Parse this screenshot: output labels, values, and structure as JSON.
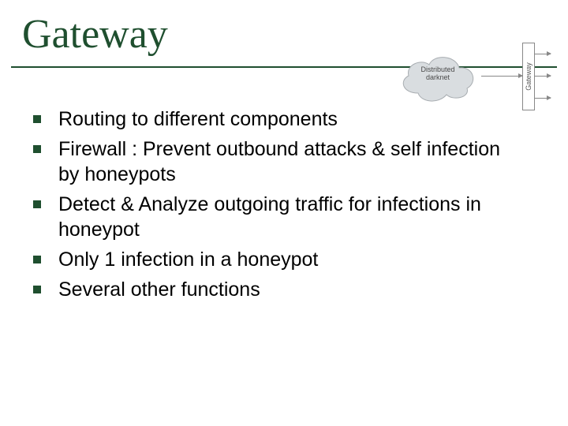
{
  "title": "Gateway",
  "diagram": {
    "cloud_label_line1": "Distributed",
    "cloud_label_line2": "darknet",
    "gateway_label": "Gateway"
  },
  "bullets": [
    "Routing to different components",
    "Firewall : Prevent outbound attacks & self infection by honeypots",
    "Detect & Analyze outgoing traffic for infections in honeypot",
    "Only 1 infection in a honeypot",
    "Several other functions"
  ]
}
